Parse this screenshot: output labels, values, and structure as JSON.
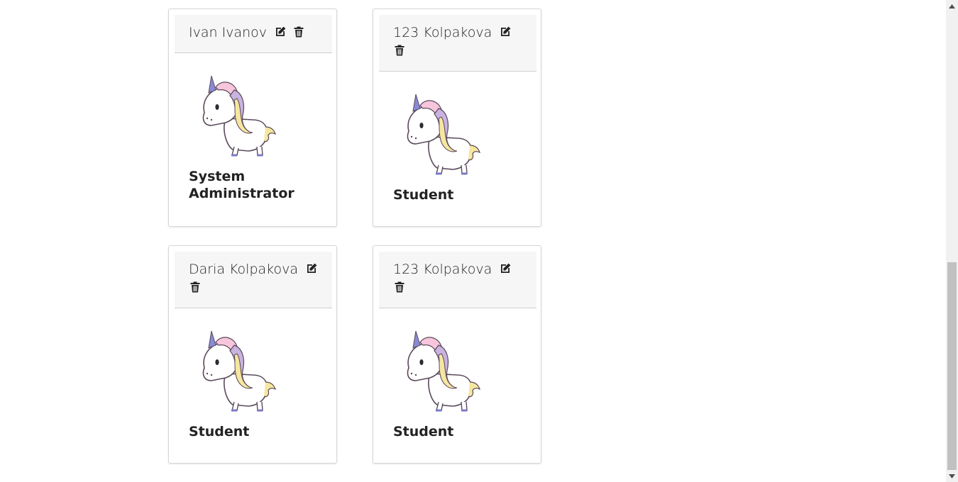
{
  "users": [
    {
      "name": "Ivan Ivanov",
      "role_line1": "System",
      "role_line2": "Administrator"
    },
    {
      "name": "123 Kolpakova",
      "role_line1": "Student",
      "role_line2": ""
    },
    {
      "name": "Daria Kolpakova",
      "role_line1": "Student",
      "role_line2": ""
    },
    {
      "name": "123 Kolpakova",
      "role_line1": "Student",
      "role_line2": ""
    }
  ],
  "icons": {
    "edit": "edit-icon",
    "delete": "trash-icon",
    "avatar": "unicorn-avatar"
  },
  "colors": {
    "header_bg": "#f6f6f6",
    "card_border": "#d6d6d6",
    "scroll_thumb": "#c1c1c1"
  }
}
